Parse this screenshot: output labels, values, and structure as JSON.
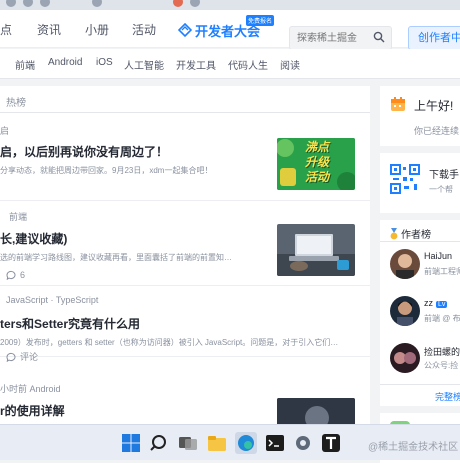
{
  "topnav": {
    "items": [
      "点",
      "资讯",
      "小册",
      "活动"
    ],
    "logo_text": "开发者大会",
    "logo_badge": "免费报名",
    "search_placeholder": "探索稀土掘金",
    "creator_label": "创作者中心"
  },
  "categories": [
    "前端",
    "Android",
    "iOS",
    "人工智能",
    "开发工具",
    "代码人生",
    "阅读"
  ],
  "feed": {
    "header": "热榜",
    "articles": [
      {
        "meta": "启",
        "title": "启，以后别再说你没有周边了！",
        "abstract": "分享动态，就能把周边带回家。9月23日，xdm一起集合吧！",
        "action": "",
        "thumb_lines": [
          "沸点",
          "升级",
          "活动"
        ]
      },
      {
        "meta": "前端",
        "title": "长,建议收藏)",
        "abstract": "选的前端学习路线图，建议收藏再看，里面囊括了前端的前置知…",
        "action": "6"
      },
      {
        "meta": "JavaScript · TypeScript",
        "title": "ters和Setter究竟有什么用",
        "abstract": "2009）发布时，getters 和 setter（也称为访问器）被引入 JavaScript。问题是，对于引入它们…",
        "action": "评论"
      },
      {
        "meta": "小时前  Android",
        "title": "r的使用详解",
        "abstract": "",
        "action": ""
      }
    ]
  },
  "sidebar": {
    "greeting": "上午好!",
    "greeting_sub": "你已经连续",
    "download_title": "下载手",
    "download_sub": "一个帮",
    "authors_title": "作者榜",
    "authors": [
      {
        "name": "HaiJun",
        "desc": "前端工程师"
      },
      {
        "name": "zz",
        "desc": "前端 @ 布"
      },
      {
        "name": "捡田螺的",
        "desc": "公众号:捡"
      }
    ],
    "more_link": "完整榜"
  },
  "watermark": "@稀土掘金技术社区"
}
